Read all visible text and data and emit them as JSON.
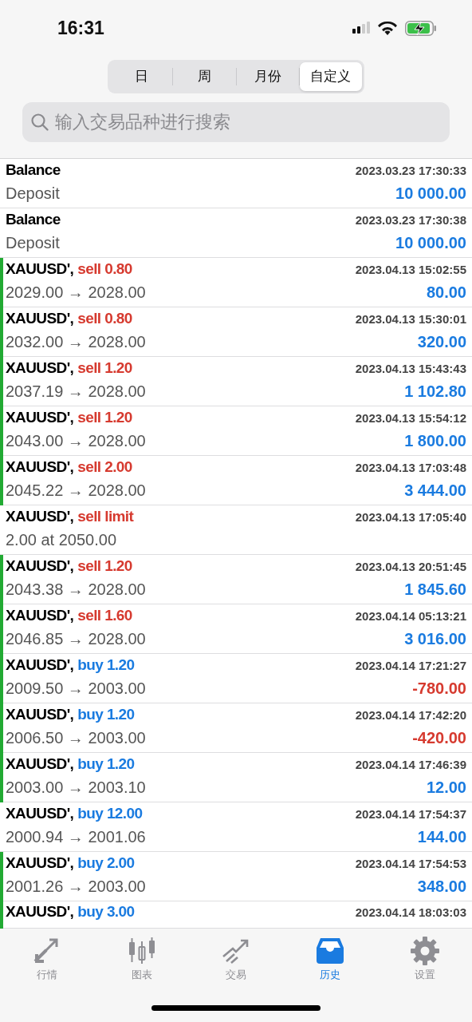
{
  "status_bar": {
    "time": "16:31"
  },
  "period_tabs": [
    {
      "label": "日",
      "selected": false
    },
    {
      "label": "周",
      "selected": false
    },
    {
      "label": "月份",
      "selected": false
    },
    {
      "label": "自定义",
      "selected": true
    }
  ],
  "search": {
    "placeholder": "输入交易品种进行搜索"
  },
  "history": [
    {
      "title": "Balance",
      "detail": "Deposit",
      "time": "2023.03.23 17:30:33",
      "profit": "10 000.00",
      "loss": false,
      "highlighted": false
    },
    {
      "title": "Balance",
      "detail": "Deposit",
      "time": "2023.03.23 17:30:38",
      "profit": "10 000.00",
      "loss": false,
      "highlighted": false
    },
    {
      "title": "XAUUSD',",
      "action": "sell 0.80",
      "is_sell": true,
      "detail": "2029.00 → 2028.00",
      "time": "2023.04.13 15:02:55",
      "profit": "80.00",
      "loss": false,
      "highlighted": true
    },
    {
      "title": "XAUUSD',",
      "action": "sell 0.80",
      "is_sell": true,
      "detail": "2032.00 → 2028.00",
      "time": "2023.04.13 15:30:01",
      "profit": "320.00",
      "loss": false,
      "highlighted": true
    },
    {
      "title": "XAUUSD',",
      "action": "sell 1.20",
      "is_sell": true,
      "detail": "2037.19 → 2028.00",
      "time": "2023.04.13 15:43:43",
      "profit": "1 102.80",
      "loss": false,
      "highlighted": true
    },
    {
      "title": "XAUUSD',",
      "action": "sell 1.20",
      "is_sell": true,
      "detail": "2043.00 → 2028.00",
      "time": "2023.04.13 15:54:12",
      "profit": "1 800.00",
      "loss": false,
      "highlighted": true
    },
    {
      "title": "XAUUSD',",
      "action": "sell 2.00",
      "is_sell": true,
      "detail": "2045.22 → 2028.00",
      "time": "2023.04.13 17:03:48",
      "profit": "3 444.00",
      "loss": false,
      "highlighted": true
    },
    {
      "title": "XAUUSD',",
      "action": "sell limit",
      "is_sell": true,
      "detail": "2.00 at 2050.00",
      "time": "2023.04.13 17:05:40",
      "highlighted": false
    },
    {
      "title": "XAUUSD',",
      "action": "sell 1.20",
      "is_sell": true,
      "detail": "2043.38 → 2028.00",
      "time": "2023.04.13 20:51:45",
      "profit": "1 845.60",
      "loss": false,
      "highlighted": true
    },
    {
      "title": "XAUUSD',",
      "action": "sell 1.60",
      "is_sell": true,
      "detail": "2046.85 → 2028.00",
      "time": "2023.04.14 05:13:21",
      "profit": "3 016.00",
      "loss": false,
      "highlighted": true
    },
    {
      "title": "XAUUSD',",
      "action": "buy 1.20",
      "is_sell": false,
      "detail": "2009.50 → 2003.00",
      "time": "2023.04.14 17:21:27",
      "profit": "-780.00",
      "loss": true,
      "highlighted": true
    },
    {
      "title": "XAUUSD',",
      "action": "buy 1.20",
      "is_sell": false,
      "detail": "2006.50 → 2003.00",
      "time": "2023.04.14 17:42:20",
      "profit": "-420.00",
      "loss": true,
      "highlighted": true
    },
    {
      "title": "XAUUSD',",
      "action": "buy 1.20",
      "is_sell": false,
      "detail": "2003.00 → 2003.10",
      "time": "2023.04.14 17:46:39",
      "profit": "12.00",
      "loss": false,
      "highlighted": true
    },
    {
      "title": "XAUUSD',",
      "action": "buy 12.00",
      "is_sell": false,
      "detail": "2000.94 → 2001.06",
      "time": "2023.04.14 17:54:37",
      "profit": "144.00",
      "loss": false,
      "highlighted": false
    },
    {
      "title": "XAUUSD',",
      "action": "buy 2.00",
      "is_sell": false,
      "detail": "2001.26 → 2003.00",
      "time": "2023.04.14 17:54:53",
      "profit": "348.00",
      "loss": false,
      "highlighted": true
    },
    {
      "title": "XAUUSD',",
      "action": "buy 3.00",
      "is_sell": false,
      "time": "2023.04.14 18:03:03",
      "highlighted": true
    }
  ],
  "bottom_tabs": [
    {
      "kind": "quotes",
      "label": "行情",
      "selected": false
    },
    {
      "kind": "chart",
      "label": "图表",
      "selected": false
    },
    {
      "kind": "trade",
      "label": "交易",
      "selected": false
    },
    {
      "kind": "history",
      "label": "历史",
      "selected": true
    },
    {
      "kind": "settings",
      "label": "设置",
      "selected": false
    }
  ]
}
